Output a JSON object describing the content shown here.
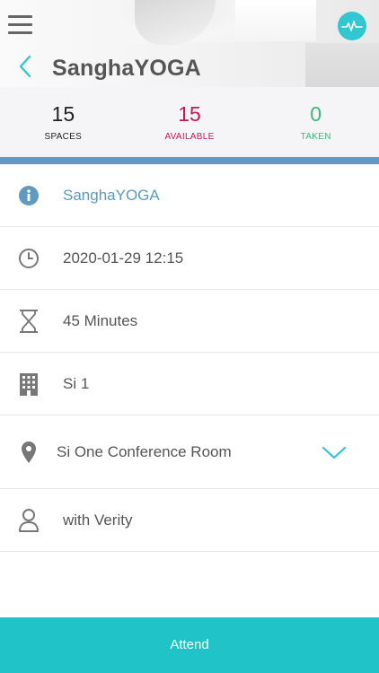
{
  "header": {
    "title": "SanghaYOGA",
    "menu_icon": "hamburger-menu-icon",
    "logo_icon": "heartbeat-logo-icon",
    "back_icon": "chevron-left-icon"
  },
  "stats": {
    "spaces": {
      "value": "15",
      "label": "SPACES",
      "color": "#222222"
    },
    "available": {
      "value": "15",
      "label": "AVAILABLE",
      "color": "#c8194d"
    },
    "taken": {
      "value": "0",
      "label": "TAKEN",
      "color": "#3cb878"
    }
  },
  "details": {
    "name": {
      "icon": "info-icon",
      "text": "SanghaYOGA"
    },
    "datetime": {
      "icon": "clock-icon",
      "text": "2020-01-29 12:15"
    },
    "duration": {
      "icon": "hourglass-icon",
      "text": "45 Minutes"
    },
    "building": {
      "icon": "building-icon",
      "text": "Si 1"
    },
    "location": {
      "icon": "map-pin-icon",
      "text": "Si One Conference Room",
      "expand_icon": "chevron-down-icon"
    },
    "instructor": {
      "icon": "user-icon",
      "text": "with Verity"
    }
  },
  "action": {
    "attend_label": "Attend"
  },
  "colors": {
    "accent": "#1fc3c8",
    "accent_bar": "#5f9ac1",
    "link": "#5a9ac2"
  }
}
